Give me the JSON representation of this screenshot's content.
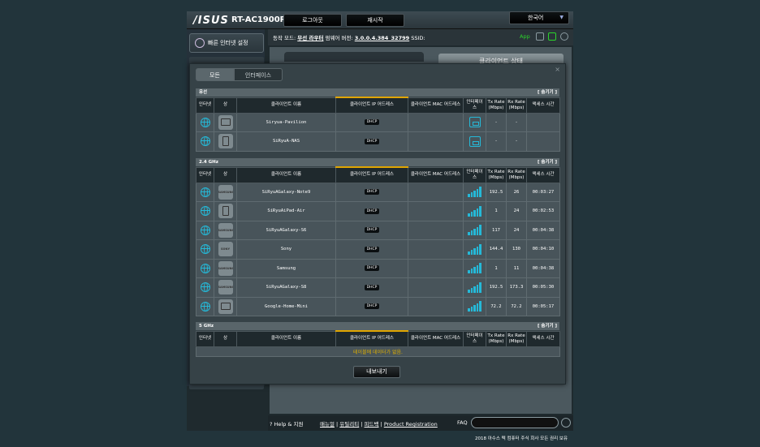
{
  "header": {
    "brand": "/ISUS",
    "model": "RT-AC1900P",
    "logout_label": "로그아웃",
    "reboot_label": "재시작",
    "language": "한국어"
  },
  "status": {
    "op_mode_label": "동작 모드:",
    "op_mode_value": "무선 라우터",
    "firmware_label": "펌웨어 버전:",
    "firmware_value": "3.0.0.4.384_32799",
    "ssid_label": "SSID:",
    "app_label": "App"
  },
  "sidebar": {
    "quick_setup": "빠른 인터넷 설정"
  },
  "background": {
    "client_status_title": "클라이언트 상태"
  },
  "modal": {
    "close": "×",
    "tabs": [
      "모든",
      "인터페이스"
    ],
    "headers": {
      "internet": "인터넷",
      "type": "상",
      "client_name": "클라이언트 이름",
      "client_ip": "클라이언트 IP 어드레스",
      "client_mac": "클라이언트 MAC 어드레스",
      "interface": "인터페이스",
      "tx_rate": "Tx Rate (Mbps)",
      "rx_rate": "Rx Rate (Mbps)",
      "access_time": "액세스 시간"
    },
    "hide_label": "[ 숨기기 ]",
    "sections": [
      {
        "title": "유선",
        "rows": [
          {
            "icon": "laptop",
            "name": "Siryua-Pavilion",
            "ip": "DHCP",
            "mac": "",
            "iface": "wired",
            "tx": "-",
            "rx": "-",
            "time": ""
          },
          {
            "icon": "nas",
            "name": "SiRyuA-NAS",
            "ip": "DHCP",
            "mac": "",
            "iface": "wired",
            "tx": "-",
            "rx": "-",
            "time": ""
          }
        ]
      },
      {
        "title": "2.4 GHz",
        "rows": [
          {
            "icon": "samsung",
            "brand_text": "SAMSUNG",
            "name": "SiRyuAGalaxy-Note9",
            "ip": "DHCP",
            "mac": "",
            "iface": "signal",
            "tx": "192.5",
            "rx": "26",
            "time": "00:03:27"
          },
          {
            "icon": "tablet",
            "name": "SiRyuAiPad-Air",
            "ip": "DHCP",
            "mac": "",
            "iface": "signal",
            "tx": "1",
            "rx": "24",
            "time": "00:02:53"
          },
          {
            "icon": "samsung",
            "brand_text": "SAMSUNG",
            "name": "SiRyuAGalaxy-S6",
            "ip": "DHCP",
            "mac": "",
            "iface": "signal",
            "tx": "117",
            "rx": "24",
            "time": "00:04:38"
          },
          {
            "icon": "sony",
            "brand_text": "SONY",
            "name": "Sony",
            "ip": "DHCP",
            "mac": "",
            "iface": "signal",
            "tx": "144.4",
            "rx": "130",
            "time": "00:04:10"
          },
          {
            "icon": "samsung",
            "brand_text": "SAMSUNG",
            "name": "Samsung",
            "ip": "DHCP",
            "mac": "",
            "iface": "signal",
            "tx": "1",
            "rx": "11",
            "time": "00:04:38"
          },
          {
            "icon": "samsung",
            "brand_text": "SAMSUNG",
            "name": "SiRyuAGalaxy-S8",
            "ip": "DHCP",
            "mac": "",
            "iface": "signal",
            "tx": "192.5",
            "rx": "173.3",
            "time": "00:05:30"
          },
          {
            "icon": "laptop",
            "name": "Google-Home-Mini",
            "ip": "DHCP",
            "mac": "",
            "iface": "signal",
            "tx": "72.2",
            "rx": "72.2",
            "time": "00:05:17"
          }
        ]
      },
      {
        "title": "5 GHz",
        "rows": [],
        "empty_message": "테이블에 데이터가 없음."
      }
    ],
    "export_label": "내보내기"
  },
  "footer": {
    "help": "Help & 지원",
    "manual": "매뉴얼",
    "utility": "유틸리티",
    "feedback": "피드백",
    "registration": "Product Registration",
    "faq": "FAQ"
  },
  "copyright": "2018 아수스 텍 컴퓨터 주식 회사 모든 권리 보유",
  "colors": {
    "accent": "#25b9d8",
    "ip_header_highlight": "#e0a500",
    "no_data_text": "#e0b000",
    "app_green": "#2bd42b"
  }
}
